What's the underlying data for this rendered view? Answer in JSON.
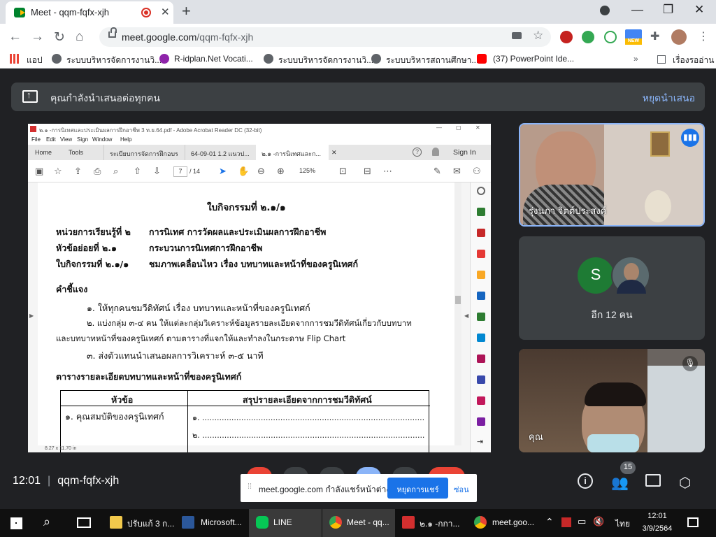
{
  "browser": {
    "tab_title": "Meet - qqm-fqfx-xjh",
    "url_domain": "meet.google.com",
    "url_path": "/qqm-fqfx-xjh",
    "new_badge": "NEW",
    "bookmarks": [
      "แอป",
      "ระบบบริหารจัดการงานวิ...",
      "R-idplan.Net Vocati...",
      "ระบบบริหารจัดการงานวิ...",
      "ระบบบริหารสถานศึกษา...",
      "(37) PowerPoint Ide..."
    ],
    "reading_list": "เรื่องรออ่าน"
  },
  "meet": {
    "presenting_text": "คุณกำลังนำเสนอต่อทุกคน",
    "stop_presenting": "หยุดนำเสนอ",
    "participants": [
      {
        "name": "รุ่งนภา จิตต์ประสงค์"
      },
      {
        "avatar_letter": "S",
        "others": "อีก 12 คน"
      },
      {
        "name": "คุณ"
      }
    ],
    "time": "12:01",
    "meeting_code": "qqm-fqfx-xjh",
    "people_count": "15",
    "share_toast": {
      "text": "meet.google.com กำลังแชร์หน้าต่าง",
      "stop": "หยุดการแชร์",
      "hide": "ซ่อน"
    }
  },
  "acrobat": {
    "title": "๒.๑ -การนิเทศและประเมินผลการฝึกอาชีพ 3 ท.ย.64.pdf - Adobe Acrobat Reader DC (32-bit)",
    "menu": [
      "File",
      "Edit",
      "View",
      "Sign",
      "Window",
      "Help"
    ],
    "tabs": [
      "Home",
      "Tools",
      "ระเบียบการจัดการฝึกอบรม...",
      "64-09-01 1.2 แนวป...",
      "๒.๑ -การนิเทศและก..."
    ],
    "sign_in": "Sign In",
    "page_current": "7",
    "page_total": "/ 14",
    "zoom": "125%",
    "page_size": "8.27 x 11.70 in",
    "doc": {
      "heading": "ใบกิจกรรมที่ ๒.๑/๑",
      "rows": [
        {
          "label": "หน่วยการเรียนรู้ที่ ๒",
          "value": "การนิเทศ การวัดผลและประเมินผลการฝึกอาชีพ"
        },
        {
          "label": "หัวข้อย่อยที่ ๒.๑",
          "value": "กระบวนการนิเทศการฝึกอาชีพ"
        },
        {
          "label": "ใบกิจกรรมที่ ๒.๑/๑",
          "value": "ชมภาพเคลื่อนไหว เรื่อง บทบาทและหน้าที่ของครูนิเทศก์"
        }
      ],
      "instructions_title": "คำชี้แจง",
      "instr1": "๑. ให้ทุกคนชมวีดิทัศน์ เรื่อง บทบาทและหน้าที่ของครูนิเทศก์",
      "instr2a": "๒. แบ่งกลุ่ม ๓-๔ คน ให้แต่ละกลุ่มวิเคราะห์ข้อมูลรายละเอียดจากการชมวีดิทัศน์เกี่ยวกับบทบาท",
      "instr2b": "และบทบาทหน้าที่ของครูนิเทศก์  ตามตารางที่แจกให้และทำลงในกระดาษ Flip Chart",
      "instr3": "๓. ส่งตัวแทนนำเสนอผลการวิเคราะห์ ๓-๕ นาที",
      "table_title": "ตารางรายละเอียดบทบาทและหน้าที่ของครูนิเทศก์",
      "col1": "หัวข้อ",
      "col2": "สรุปรายละเอียดจากการชมวีดิทัศน์",
      "cell1": "๑. คุณสมบัติของครูนิเทศก์",
      "line1": "๑. ...........................................................................................",
      "line2": "๒. ..........................................................................................."
    }
  },
  "taskbar": {
    "items": [
      "ปรับแก้ 3 ก...",
      "Microsoft...",
      "LINE",
      "Meet - qq...",
      "๒.๑ -กกา...",
      "meet.goo..."
    ],
    "lang": "ไทย",
    "time": "12:01",
    "date": "3/9/2564"
  },
  "colors": {
    "meet_bg": "#202124",
    "accent": "#8ab4f8",
    "stop_share": "#1a73e8"
  }
}
